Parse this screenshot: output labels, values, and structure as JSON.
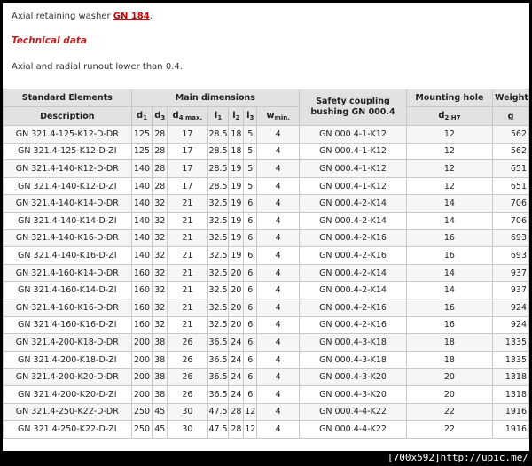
{
  "intro": {
    "text": "Axial retaining washer ",
    "link": "GN 184",
    "period": ".",
    "section_title": "Technical data",
    "note": "Axial and radial runout lower than 0.4."
  },
  "table": {
    "group_headers": {
      "standard_elements": "Standard Elements",
      "main_dimensions": "Main dimensions",
      "safety_coupling": "Safety coupling bushing GN 000.4",
      "mounting_hole": "Mounting hole",
      "weight": "Weight"
    },
    "column_headers": {
      "description": "Description",
      "d1": "d",
      "d1_sub": "1",
      "d3": "d",
      "d3_sub": "3",
      "d4": "d",
      "d4_sub": "4 max.",
      "l1": "l",
      "l1_sub": "1",
      "l2": "l",
      "l2_sub": "2",
      "l3": "l",
      "l3_sub": "3",
      "w": "w",
      "w_sub": "min.",
      "d2": "d",
      "d2_sub": "2 H7",
      "g": "g"
    },
    "rows": [
      {
        "desc": "GN 321.4-125-K12-D-DR",
        "d1": "125",
        "d3": "28",
        "d4": "17",
        "l1": "28.5",
        "l2": "18",
        "l3": "5",
        "w": "4",
        "bushing": "GN 000.4-1-K12",
        "d2": "12",
        "g": "562"
      },
      {
        "desc": "GN 321.4-125-K12-D-ZI",
        "d1": "125",
        "d3": "28",
        "d4": "17",
        "l1": "28.5",
        "l2": "18",
        "l3": "5",
        "w": "4",
        "bushing": "GN 000.4-1-K12",
        "d2": "12",
        "g": "562"
      },
      {
        "desc": "GN 321.4-140-K12-D-DR",
        "d1": "140",
        "d3": "28",
        "d4": "17",
        "l1": "28.5",
        "l2": "19",
        "l3": "5",
        "w": "4",
        "bushing": "GN 000.4-1-K12",
        "d2": "12",
        "g": "651"
      },
      {
        "desc": "GN 321.4-140-K12-D-ZI",
        "d1": "140",
        "d3": "28",
        "d4": "17",
        "l1": "28.5",
        "l2": "19",
        "l3": "5",
        "w": "4",
        "bushing": "GN 000.4-1-K12",
        "d2": "12",
        "g": "651"
      },
      {
        "desc": "GN 321.4-140-K14-D-DR",
        "d1": "140",
        "d3": "32",
        "d4": "21",
        "l1": "32.5",
        "l2": "19",
        "l3": "6",
        "w": "4",
        "bushing": "GN 000.4-2-K14",
        "d2": "14",
        "g": "706"
      },
      {
        "desc": "GN 321.4-140-K14-D-ZI",
        "d1": "140",
        "d3": "32",
        "d4": "21",
        "l1": "32.5",
        "l2": "19",
        "l3": "6",
        "w": "4",
        "bushing": "GN 000.4-2-K14",
        "d2": "14",
        "g": "706"
      },
      {
        "desc": "GN 321.4-140-K16-D-DR",
        "d1": "140",
        "d3": "32",
        "d4": "21",
        "l1": "32.5",
        "l2": "19",
        "l3": "6",
        "w": "4",
        "bushing": "GN 000.4-2-K16",
        "d2": "16",
        "g": "693"
      },
      {
        "desc": "GN 321.4-140-K16-D-ZI",
        "d1": "140",
        "d3": "32",
        "d4": "21",
        "l1": "32.5",
        "l2": "19",
        "l3": "6",
        "w": "4",
        "bushing": "GN 000.4-2-K16",
        "d2": "16",
        "g": "693"
      },
      {
        "desc": "GN 321.4-160-K14-D-DR",
        "d1": "160",
        "d3": "32",
        "d4": "21",
        "l1": "32.5",
        "l2": "20",
        "l3": "6",
        "w": "4",
        "bushing": "GN 000.4-2-K14",
        "d2": "14",
        "g": "937"
      },
      {
        "desc": "GN 321.4-160-K14-D-ZI",
        "d1": "160",
        "d3": "32",
        "d4": "21",
        "l1": "32.5",
        "l2": "20",
        "l3": "6",
        "w": "4",
        "bushing": "GN 000.4-2-K14",
        "d2": "14",
        "g": "937"
      },
      {
        "desc": "GN 321.4-160-K16-D-DR",
        "d1": "160",
        "d3": "32",
        "d4": "21",
        "l1": "32.5",
        "l2": "20",
        "l3": "6",
        "w": "4",
        "bushing": "GN 000.4-2-K16",
        "d2": "16",
        "g": "924"
      },
      {
        "desc": "GN 321.4-160-K16-D-ZI",
        "d1": "160",
        "d3": "32",
        "d4": "21",
        "l1": "32.5",
        "l2": "20",
        "l3": "6",
        "w": "4",
        "bushing": "GN 000.4-2-K16",
        "d2": "16",
        "g": "924"
      },
      {
        "desc": "GN 321.4-200-K18-D-DR",
        "d1": "200",
        "d3": "38",
        "d4": "26",
        "l1": "36.5",
        "l2": "24",
        "l3": "6",
        "w": "4",
        "bushing": "GN 000.4-3-K18",
        "d2": "18",
        "g": "1335"
      },
      {
        "desc": "GN 321.4-200-K18-D-ZI",
        "d1": "200",
        "d3": "38",
        "d4": "26",
        "l1": "36.5",
        "l2": "24",
        "l3": "6",
        "w": "4",
        "bushing": "GN 000.4-3-K18",
        "d2": "18",
        "g": "1335"
      },
      {
        "desc": "GN 321.4-200-K20-D-DR",
        "d1": "200",
        "d3": "38",
        "d4": "26",
        "l1": "36.5",
        "l2": "24",
        "l3": "6",
        "w": "4",
        "bushing": "GN 000.4-3-K20",
        "d2": "20",
        "g": "1318"
      },
      {
        "desc": "GN 321.4-200-K20-D-ZI",
        "d1": "200",
        "d3": "38",
        "d4": "26",
        "l1": "36.5",
        "l2": "24",
        "l3": "6",
        "w": "4",
        "bushing": "GN 000.4-3-K20",
        "d2": "20",
        "g": "1318"
      },
      {
        "desc": "GN 321.4-250-K22-D-DR",
        "d1": "250",
        "d3": "45",
        "d4": "30",
        "l1": "47.5",
        "l2": "28",
        "l3": "12",
        "w": "4",
        "bushing": "GN 000.4-4-K22",
        "d2": "22",
        "g": "1916"
      },
      {
        "desc": "GN 321.4-250-K22-D-ZI",
        "d1": "250",
        "d3": "45",
        "d4": "30",
        "l1": "47.5",
        "l2": "28",
        "l3": "12",
        "w": "4",
        "bushing": "GN 000.4-4-K22",
        "d2": "22",
        "g": "1916"
      }
    ]
  },
  "footer": {
    "dims": "[700x592]",
    "url": "http://upic.me/"
  }
}
